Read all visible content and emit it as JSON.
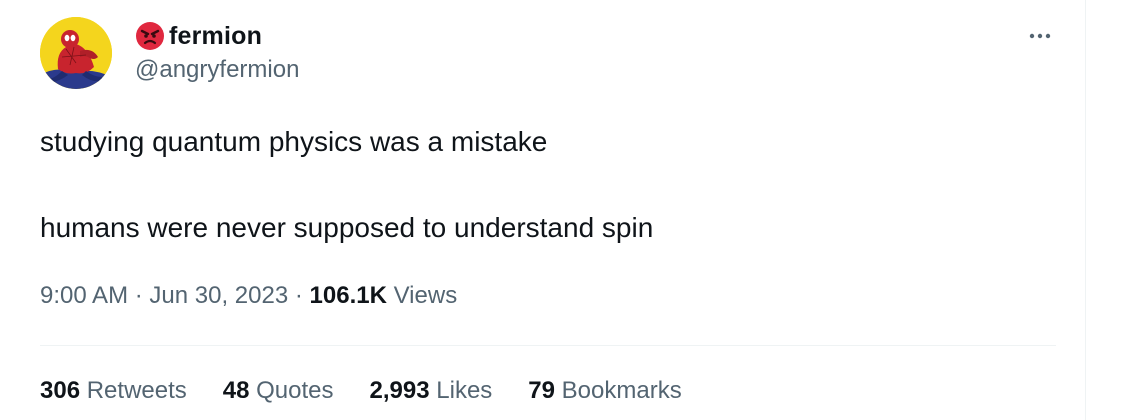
{
  "tweet": {
    "author": {
      "display_name": "fermion",
      "handle": "@angryfermion",
      "emoji": "angry-face-emoji"
    },
    "text_lines": [
      "studying quantum physics was a mistake",
      "humans were never supposed to understand spin"
    ],
    "meta": {
      "time": "9:00 AM",
      "separator": "·",
      "date": "Jun 30, 2023",
      "views_count": "106.1K",
      "views_label": "Views"
    },
    "stats": [
      {
        "count": "306",
        "label": "Retweets"
      },
      {
        "count": "48",
        "label": "Quotes"
      },
      {
        "count": "2,993",
        "label": "Likes"
      },
      {
        "count": "79",
        "label": "Bookmarks"
      }
    ],
    "more_icon": "more-horizontal-icon"
  },
  "colors": {
    "text_primary": "#0f1419",
    "text_secondary": "#536471",
    "divider": "#eff3f4",
    "avatar_bg": "#f4d51d",
    "emoji_red": "#e0283f"
  }
}
